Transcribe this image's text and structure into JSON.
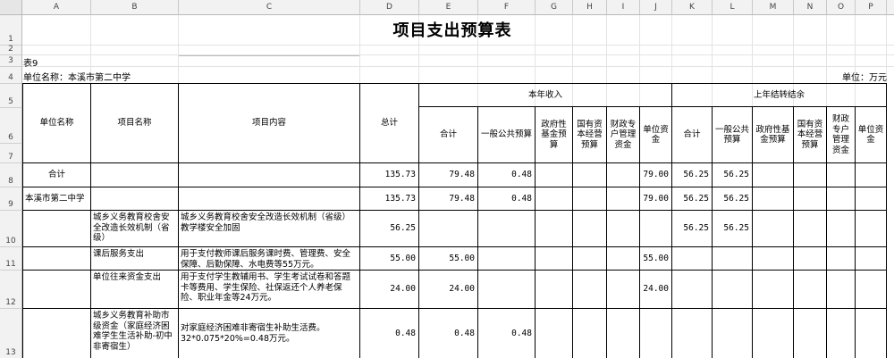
{
  "sheet": {
    "columns": [
      "A",
      "B",
      "C",
      "D",
      "E",
      "F",
      "G",
      "H",
      "I",
      "J",
      "K",
      "L",
      "M",
      "N",
      "O",
      "P"
    ],
    "rows": [
      "1",
      "2",
      "3",
      "4",
      "5",
      "6",
      "7",
      "8",
      "9",
      "10",
      "11",
      "12",
      "13"
    ]
  },
  "report": {
    "title": "项目支出预算表",
    "table_no": "表9",
    "unit_name": "单位名称：本溪市第二中学",
    "unit": "单位：万元"
  },
  "headers": {
    "unit_name": "单位名称",
    "project_name": "项目名称",
    "project_content": "项目内容",
    "total": "总计",
    "current_income": "本年收入",
    "prior_carryover": "上年结转结余",
    "sub": [
      "合计",
      "一般公共预算",
      "政府性基金预算",
      "国有资本经营预算",
      "财政专户管理资金",
      "单位资金"
    ]
  },
  "rows": [
    {
      "unit": "合计",
      "project": "",
      "content": "",
      "total": "135.73",
      "cur": [
        "79.48",
        "0.48",
        "",
        "",
        "",
        "79.00"
      ],
      "prev": [
        "56.25",
        "56.25",
        "",
        "",
        "",
        ""
      ]
    },
    {
      "unit": "本溪市第二中学",
      "project": "",
      "content": "",
      "total": "135.73",
      "cur": [
        "79.48",
        "0.48",
        "",
        "",
        "",
        "79.00"
      ],
      "prev": [
        "56.25",
        "56.25",
        "",
        "",
        "",
        ""
      ]
    },
    {
      "unit": "",
      "project": "城乡义务教育校舍安全改造长效机制（省级）",
      "content": "城乡义务教育校舍安全改造长效机制（省级）教学楼安全加固",
      "total": "56.25",
      "cur": [
        "",
        "",
        "",
        "",
        "",
        ""
      ],
      "prev": [
        "56.25",
        "56.25",
        "",
        "",
        "",
        ""
      ]
    },
    {
      "unit": "",
      "project": "课后服务支出",
      "content": "用于支付教师课后服务课时费、管理费、安全保障、后勤保障、水电费等55万元。",
      "total": "55.00",
      "cur": [
        "55.00",
        "",
        "",
        "",
        "",
        "55.00"
      ],
      "prev": [
        "",
        "",
        "",
        "",
        "",
        ""
      ]
    },
    {
      "unit": "",
      "project": "单位往来资金支出",
      "content": "用于支付学生教辅用书、学生考试试卷和答题卡等费用、学生保险、社保返还个人养老保险、职业年金等24万元。",
      "total": "24.00",
      "cur": [
        "24.00",
        "",
        "",
        "",
        "",
        "24.00"
      ],
      "prev": [
        "",
        "",
        "",
        "",
        "",
        ""
      ]
    },
    {
      "unit": "",
      "project": "城乡义务教育补助市级资金（家庭经济困难学生生活补助-初中非寄宿生）",
      "content": "对家庭经济困难非寄宿生补助生活费。32*0.075*20%=0.48万元。",
      "total": "0.48",
      "cur": [
        "0.48",
        "0.48",
        "",
        "",
        "",
        ""
      ],
      "prev": [
        "",
        "",
        "",
        "",
        "",
        ""
      ]
    }
  ]
}
